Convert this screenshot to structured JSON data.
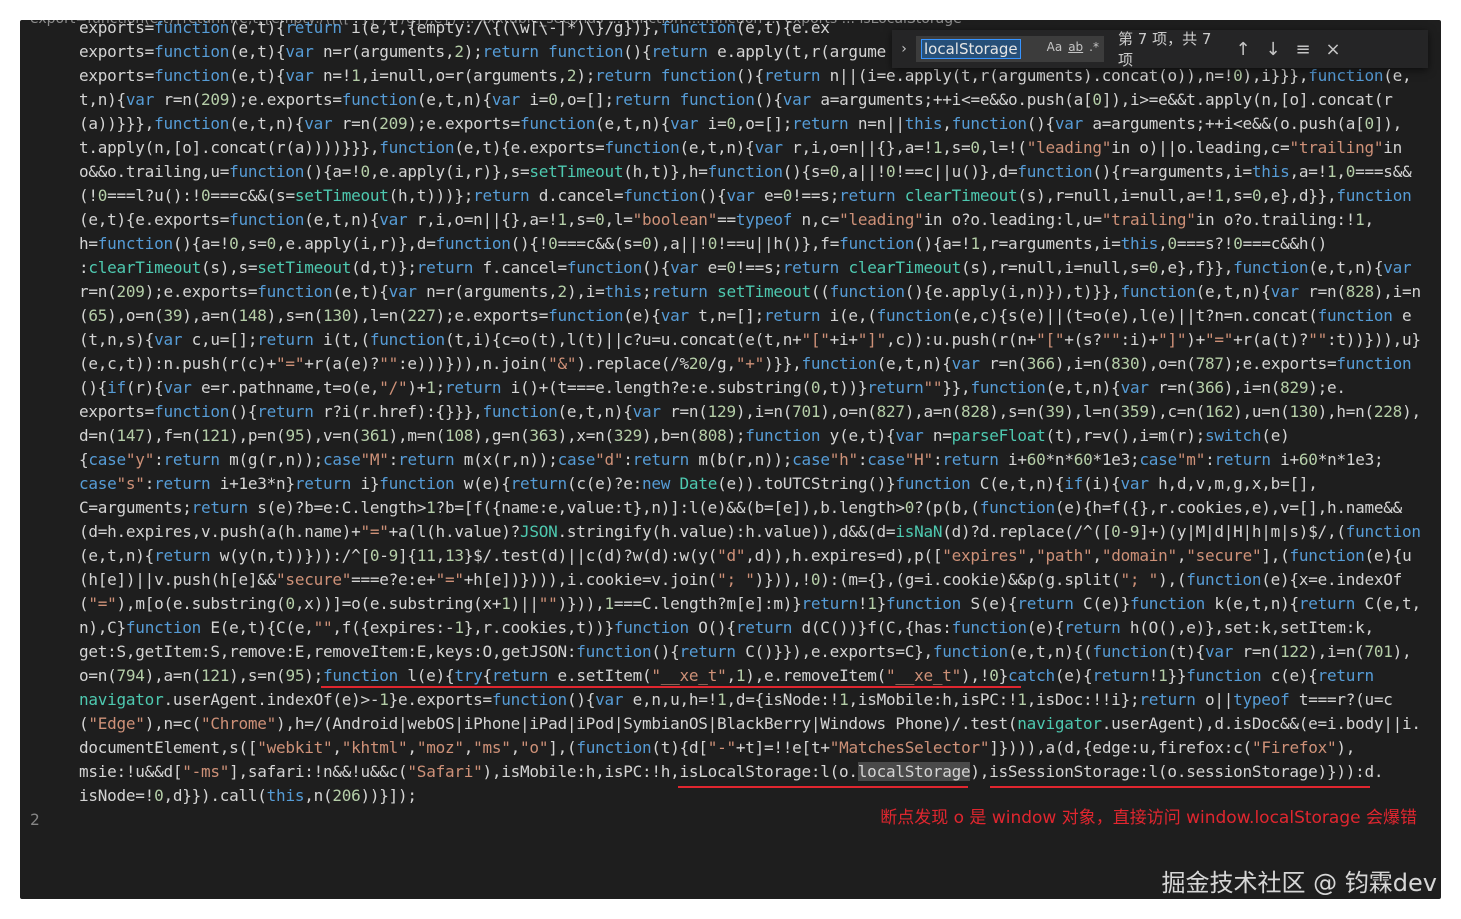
{
  "editor": {
    "breadcrumb": "export=function(e,t){return i(e,t,{empty:/\\{([^}]*)\\}/g}),e}) ... xxxtable_seconds ... function ... function ... exports ... isLocalStorage",
    "line_number": "2",
    "code_lines": [
      "exports=function(e,t){return i(e,t,{empty:/\\{(\\w[\\-]*)\\}/g})},function(e,t){e.ex",
      "exports=function(e,t){var n=r(arguments,2);return function(){return e.apply(t,r(argume",
      "exports=function(e,t){var n=!1,i=null,o=r(arguments,2);return function(){return n||(i=e.apply(t,r(arguments).concat(o)),n=!0),i}}},function(e,",
      "t,n){var r=n(209);e.exports=function(e,t,n){var i=0,o=[];return function(){var a=arguments;++i<=e&&o.push(a[0]),i>=e&&t.apply(n,[o].concat(r",
      "(a))}}},function(e,t,n){var r=n(209);e.exports=function(e,t,n){var i=0,o=[];return n=n||this,function(){var a=arguments;++i<e&&(o.push(a[0]),",
      "t.apply(n,[o].concat(r(a))))}}},function(e,t){e.exports=function(e,t,n){var r,i,o=n||{},a=!1,s=0,l=!(\"leading\"in o)||o.leading,c=\"trailing\"in",
      "o&&o.trailing,u=function(){a=!0,e.apply(i,r)},s=setTimeout(h,t)},h=function(){s=0,a||!0!==c||u()},d=function(){r=arguments,i=this,a=!1,0===s&&",
      "(!0===l?u():!0===c&&(s=setTimeout(h,t)))};return d.cancel=function(){var e=0!==s;return clearTimeout(s),r=null,i=null,a=!1,s=0,e},d}},function",
      "(e,t){e.exports=function(e,t,n){var r,i,o=n||{},a=!1,s=0,l=\"boolean\"==typeof n,c=\"leading\"in o?o.leading:l,u=\"trailing\"in o?o.trailing:!1,",
      "h=function(){a=!0,s=0,e.apply(i,r)},d=function(){!0===c&&(s=0),a||!0!==u||h()},f=function(){a=!1,r=arguments,i=this,0===s?!0===c&&h()",
      ":clearTimeout(s),s=setTimeout(d,t)};return f.cancel=function(){var e=0!==s;return clearTimeout(s),r=null,i=null,s=0,e},f}},function(e,t,n){var",
      "r=n(209);e.exports=function(e,t){var n=r(arguments,2),i=this;return setTimeout((function(){e.apply(i,n)}),t)}},function(e,t,n){var r=n(828),i=n",
      "(65),o=n(39),a=n(148),s=n(130),l=n(227);e.exports=function(e){var t,n=[];return i(e,(function(e,c){s(e)||(t=o(e),l(e)||t?n=n.concat(function e",
      "(t,n,s){var c,u=[];return i(t,(function(t,i){c=o(t),l(t)||c?u=u.concat(e(t,n+\"[\"+i+\"]\",c)):u.push(r(n+\"[\"+(s?\"\":i)+\"]\")+\"=\"+r(a(t)?\"\":t))})),u}",
      "(e,c,t)):n.push(r(c)+\"=\"+r(a(e)?\"\":e)))})),n.join(\"&\").replace(/%20/g,\"+\")}},function(e,t,n){var r=n(366),i=n(830),o=n(787);e.exports=function",
      "(){if(r){var e=r.pathname,t=o(e,\"/\")+1;return i()+(t===e.length?e:e.substring(0,t))}return\"\"}},function(e,t,n){var r=n(366),i=n(829);e.",
      "exports=function(){return r?i(r.href):{}}},function(e,t,n){var r=n(129),i=n(701),o=n(827),a=n(828),s=n(39),l=n(359),c=n(162),u=n(130),h=n(228),",
      "d=n(147),f=n(121),p=n(95),v=n(361),m=n(108),g=n(363),x=n(329),b=n(808);function y(e,t){var n=parseFloat(t),r=v(),i=m(r);switch(e)",
      "{case\"y\":return m(g(r,n));case\"M\":return m(x(r,n));case\"d\":return m(b(r,n));case\"h\":case\"H\":return i+60*n*60*1e3;case\"m\":return i+60*n*1e3;",
      "case\"s\":return i+1e3*n}return i}function w(e){return(c(e)?e:new Date(e)).toUTCString()}function C(e,t,n){if(i){var h,d,v,m,g,x,b=[],",
      "C=arguments;return s(e)?b=e:C.length>1?b=[f({name:e,value:t},n)]:l(e)&&(b=[e]),b.length>0?(p(b,(function(e){h=f({},r.cookies,e),v=[],h.name&&",
      "(d=h.expires,v.push(a(h.name)+\"=\"+a(l(h.value)?JSON.stringify(h.value):h.value)),d&&(d=isNaN(d)?d.replace(/^([0-9]+)(y|M|d|H|h|m|s)$/,(function",
      "(e,t,n){return w(y(n,t))})):/^[0-9]{11,13}$/.test(d)||c(d)?w(d):w(y(\"d\",d)),h.expires=d),p([\"expires\",\"path\",\"domain\",\"secure\"],(function(e){u",
      "(h[e])||v.push(h[e]&&\"secure\"===e?e:e+\"=\"+h[e])}))),i.cookie=v.join(\"; \")})),!0):(m={},(g=i.cookie)&&p(g.split(\"; \"),(function(e){x=e.indexOf",
      "(\"=\"),m[o(e.substring(0,x))]=o(e.substring(x+1)||\"\")})),1===C.length?m[e]:m)}return!1}function S(e){return C(e)}function k(e,t,n){return C(e,t,",
      "n),C}function E(e,t){C(e,\"\",f({expires:-1},r.cookies,t))}function O(){return d(C())}f(C,{has:function(e){return h(O(),e)},set:k,setItem:k,",
      "get:S,getItem:S,remove:E,removeItem:E,keys:O,getJSON:function(){return C()}}),e.exports=C},function(e,t,n){(function(t){var r=n(122),i=n(701),",
      "o=n(794),a=n(121),s=n(95);function l(e){try{return e.setItem(\"__xe_t\",1),e.removeItem(\"__xe_t\"),!0}catch(e){return!1}}function c(e){return",
      "navigator.userAgent.indexOf(e)>-1}e.exports=function(){var e,n,u,h=!1,d={isNode:!1,isMobile:h,isPC:!1,isDoc:!!i};return o||typeof t===r?(u=c",
      "(\"Edge\"),n=c(\"Chrome\"),h=/(Android|webOS|iPhone|iPad|iPod|SymbianOS|BlackBerry|Windows Phone)/.test(navigator.userAgent),d.isDoc&&(e=i.body||i.",
      "documentElement,s([\"webkit\",\"khtml\",\"moz\",\"ms\",\"o\"],(function(t){d[\"-\"+t]=!!e[t+\"MatchesSelector\"]}))),a(d,{edge:u,firefox:c(\"Firefox\"),",
      "msie:!u&&d[\"-ms\"],safari:!n&&!u&&c(\"Safari\"),isMobile:h,isPC:!h,isLocalStorage:l(o.localStorage),isSessionStorage:l(o.sessionStorage)})):d.",
      "isNode=!0,d}}).call(this,n(206))}]);"
    ]
  },
  "find": {
    "value": "localStorage",
    "match_case": "Aa",
    "whole_word": "ab",
    "regex": ".*",
    "count": "第 7 项，共 7 项",
    "toggle_icon": "chevron-right-icon",
    "prev_icon": "arrow-up-icon",
    "next_icon": "arrow-down-icon",
    "selection_icon": "find-in-selection-icon",
    "close_icon": "close-icon"
  },
  "annotation": "断点发现 o 是 window 对象，直接访问 window.localStorage 会爆错",
  "watermark": "掘金技术社区 @ 钧霖dev",
  "colors": {
    "annotation_red": "#e0262f",
    "editor_bg": "#1e1e1e"
  }
}
